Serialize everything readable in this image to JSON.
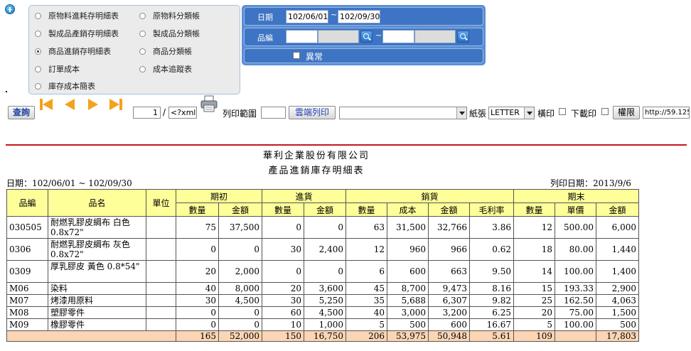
{
  "report_options": {
    "left": [
      {
        "label": "原物料進耗存明細表",
        "selected": false
      },
      {
        "label": "製成品產銷存明細表",
        "selected": false
      },
      {
        "label": "商品進銷存明細表",
        "selected": true
      },
      {
        "label": "訂單成本",
        "selected": false
      },
      {
        "label": "庫存成本簡表",
        "selected": false
      }
    ],
    "right": [
      {
        "label": "原物料分類帳",
        "selected": false
      },
      {
        "label": "製成品分類帳",
        "selected": false
      },
      {
        "label": "商品分類帳",
        "selected": false
      },
      {
        "label": "成本追蹤表",
        "selected": false
      }
    ]
  },
  "filter": {
    "date_label": "日期",
    "date_from": "102/06/01",
    "date_sep": "~",
    "date_to": "102/09/30",
    "product_label": "品編",
    "product_sep": "~",
    "abnormal_label": "異常"
  },
  "toolbar": {
    "query_label": "查詢",
    "page_value": "1",
    "page_sep": "/",
    "page_total": "<?xml v",
    "print_range_label": "列印範圍",
    "cloud_print_label": "雲端列印",
    "paper_label": "紙張",
    "paper_value": "LETTER",
    "landscape_label": "橫印",
    "download_label": "下載印",
    "permission_label": "權限",
    "url_value": "http://59.125"
  },
  "report": {
    "company": "華利企業股份有限公司",
    "title": "產品進銷庫存明細表",
    "period": "日期：102/06/01 ~ 102/09/30",
    "print_date": "列印日期：2013/9/6",
    "group_headers": [
      "品編",
      "品名",
      "單位",
      "期初",
      "進貨",
      "銷貨",
      "期末"
    ],
    "sub_headers": [
      "數量",
      "金額",
      "數量",
      "金額",
      "數量",
      "成本",
      "金額",
      "毛利率",
      "數量",
      "單價",
      "金額"
    ],
    "rows": [
      {
        "code": "030505",
        "name": "耐燃乳膠皮綢布 白色 0.8x72\"",
        "unit": "",
        "vals": [
          "75",
          "37,500",
          "0",
          "0",
          "63",
          "31,500",
          "32,766",
          "3.86",
          "12",
          "500.00",
          "6,000"
        ]
      },
      {
        "code": "0306",
        "name": "耐燃乳膠皮綢布 灰色 0.8x72\"",
        "unit": "",
        "vals": [
          "0",
          "0",
          "30",
          "2,400",
          "12",
          "960",
          "966",
          "0.62",
          "18",
          "80.00",
          "1,440"
        ]
      },
      {
        "code": "0309",
        "name": "厚乳膠皮 黃色 0.8*54\"",
        "unit": "",
        "vals": [
          "20",
          "2,000",
          "0",
          "0",
          "6",
          "600",
          "663",
          "9.50",
          "14",
          "100.00",
          "1,400"
        ]
      },
      {
        "code": "M06",
        "name": "染料",
        "unit": "",
        "vals": [
          "40",
          "8,000",
          "20",
          "3,600",
          "45",
          "8,700",
          "9,473",
          "8.16",
          "15",
          "193.33",
          "2,900"
        ]
      },
      {
        "code": "M07",
        "name": "烤漆用原料",
        "unit": "",
        "vals": [
          "30",
          "4,500",
          "30",
          "5,250",
          "35",
          "5,688",
          "6,307",
          "9.82",
          "25",
          "162.50",
          "4,063"
        ]
      },
      {
        "code": "M08",
        "name": "塑膠零件",
        "unit": "",
        "vals": [
          "0",
          "0",
          "60",
          "4,500",
          "40",
          "3,000",
          "3,200",
          "6.25",
          "20",
          "75.00",
          "1,500"
        ]
      },
      {
        "code": "M09",
        "name": "橡膠零件",
        "unit": "",
        "vals": [
          "0",
          "0",
          "10",
          "1,000",
          "5",
          "500",
          "600",
          "16.67",
          "5",
          "100.00",
          "500"
        ]
      }
    ],
    "totals": [
      "165",
      "52,000",
      "150",
      "16,750",
      "206",
      "53,975",
      "50,948",
      "5.61",
      "109",
      "",
      "17,803"
    ]
  }
}
